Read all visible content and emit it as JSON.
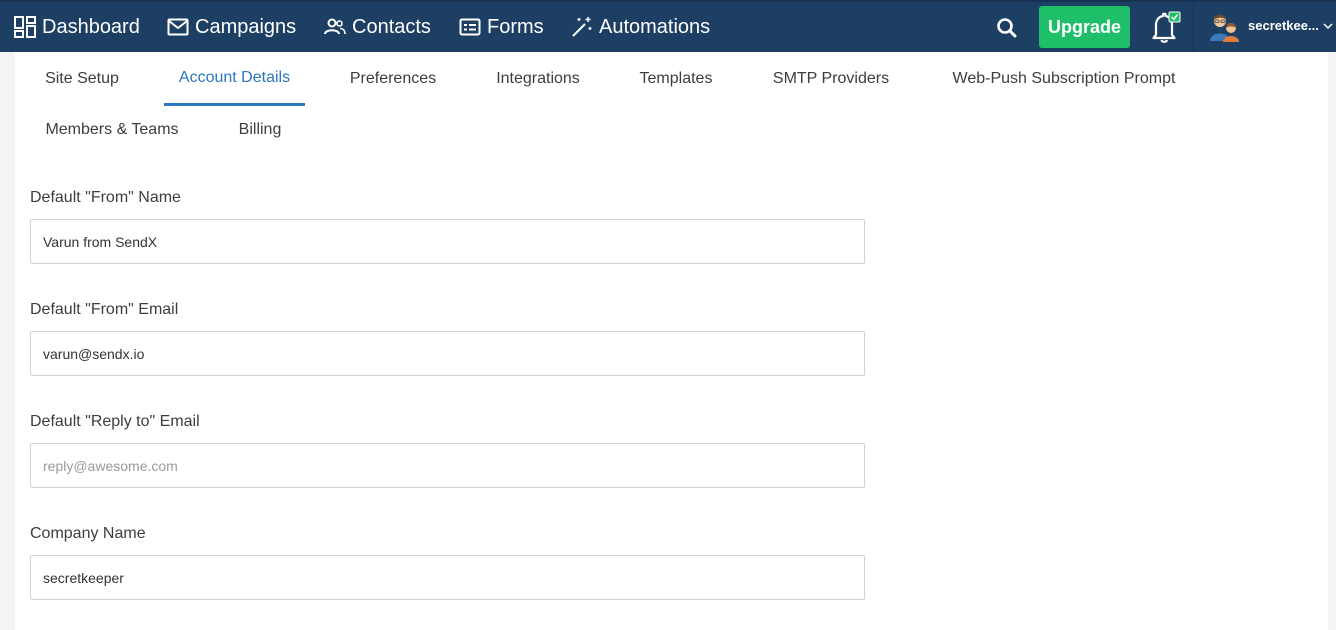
{
  "nav": {
    "items": [
      {
        "label": "Dashboard",
        "icon": "dashboard-icon"
      },
      {
        "label": "Campaigns",
        "icon": "mail-icon"
      },
      {
        "label": "Contacts",
        "icon": "people-icon"
      },
      {
        "label": "Forms",
        "icon": "form-icon"
      },
      {
        "label": "Automations",
        "icon": "magic-wand-icon"
      }
    ],
    "upgrade_label": "Upgrade",
    "user_name": "secretkee...",
    "colors": {
      "bar": "#1d3f63",
      "upgrade": "#1fbf6a",
      "accent": "#2a76c0"
    }
  },
  "tabs": [
    {
      "label": "Site Setup"
    },
    {
      "label": "Account Details"
    },
    {
      "label": "Preferences"
    },
    {
      "label": "Integrations"
    },
    {
      "label": "Templates"
    },
    {
      "label": "SMTP Providers"
    },
    {
      "label": "Web-Push Subscription Prompt"
    },
    {
      "label": "Members & Teams"
    },
    {
      "label": "Billing"
    }
  ],
  "active_tab": "Account Details",
  "form": {
    "from_name": {
      "label": "Default \"From\" Name",
      "value": "Varun from SendX",
      "placeholder": ""
    },
    "from_email": {
      "label": "Default \"From\" Email",
      "value": "varun@sendx.io",
      "placeholder": ""
    },
    "reply_to": {
      "label": "Default \"Reply to\" Email",
      "value": "",
      "placeholder": "reply@awesome.com"
    },
    "company": {
      "label": "Company Name",
      "value": "secretkeeper",
      "placeholder": ""
    }
  }
}
